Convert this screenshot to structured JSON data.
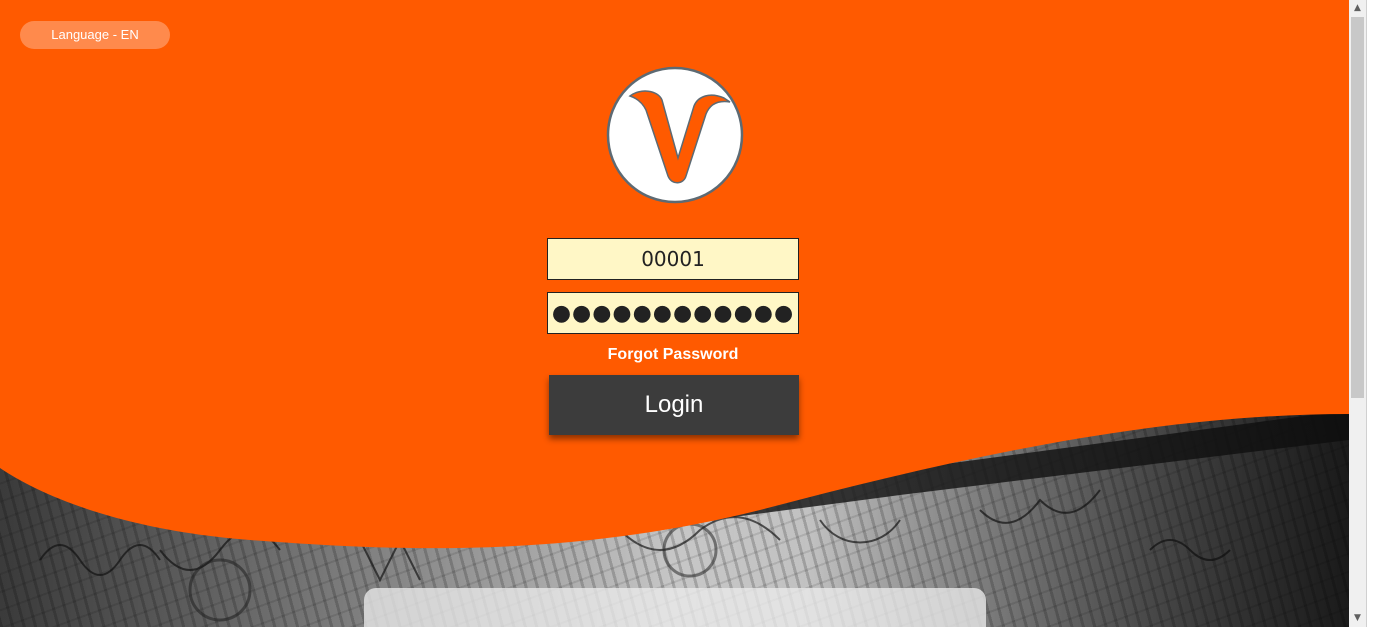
{
  "header": {
    "language_label": "Language - EN"
  },
  "logo": {
    "letter": "V",
    "icon": "v-logo-icon"
  },
  "login_form": {
    "username_value": "00001",
    "password_value": "●●●●●●●●●●●●",
    "forgot_password_label": "Forgot Password",
    "login_label": "Login"
  },
  "scrollbar": {
    "up_arrow": "▲",
    "down_arrow": "▼"
  },
  "colors": {
    "brand_orange": "#ff5a00",
    "input_background": "#fff7c6",
    "login_button": "#3c3c3c"
  }
}
